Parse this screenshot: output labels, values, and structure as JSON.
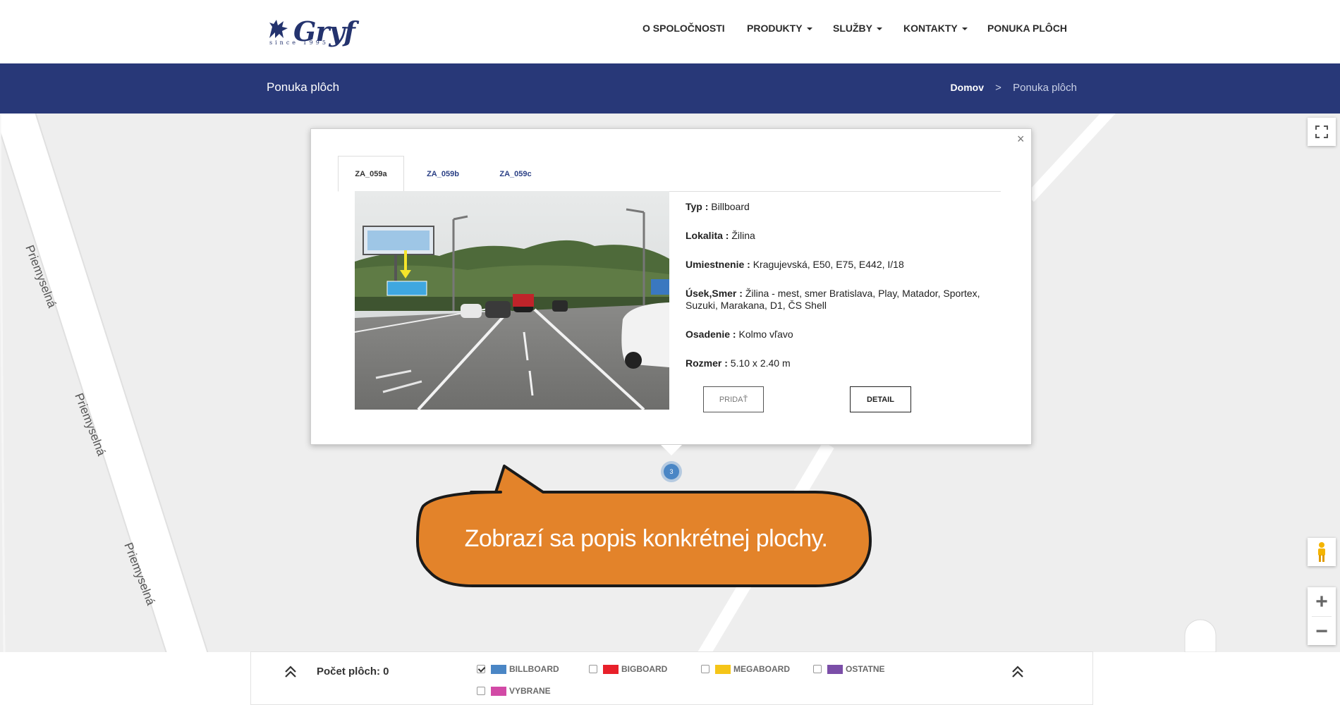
{
  "header": {
    "logo": {
      "wordmark": "Gryf",
      "tagline": "since 1995"
    },
    "nav": [
      {
        "label": "O SPOLOČNOSTI",
        "dropdown": false
      },
      {
        "label": "PRODUKTY",
        "dropdown": true
      },
      {
        "label": "SLUŽBY",
        "dropdown": true
      },
      {
        "label": "KONTAKTY",
        "dropdown": true
      },
      {
        "label": "PONUKA PLÔCH",
        "dropdown": false
      }
    ]
  },
  "titlebar": {
    "title": "Ponuka plôch",
    "breadcrumb": {
      "home": "Domov",
      "separator": ">",
      "current": "Ponuka plôch"
    },
    "background": "#283878"
  },
  "map": {
    "street_labels": [
      "Priemyselná",
      "Priemyselná",
      "Priemyselná"
    ],
    "controls": {
      "fullscreen_icon": "fullscreen-icon",
      "pegman_icon": "pegman-icon",
      "zoom_in": "+",
      "zoom_out": "−"
    },
    "cluster": {
      "count": "3",
      "color": "#4a86c5"
    }
  },
  "popup": {
    "close": "×",
    "tabs": [
      {
        "label": "ZA_059a",
        "active": true
      },
      {
        "label": "ZA_059b",
        "active": false
      },
      {
        "label": "ZA_059c",
        "active": false
      }
    ],
    "details": {
      "typ": {
        "label": "Typ :",
        "value": "Billboard"
      },
      "lokalita": {
        "label": "Lokalita :",
        "value": "Žilina"
      },
      "umiestnenie": {
        "label": "Umiestnenie :",
        "value": "Kragujevská, E50, E75, E442, I/18"
      },
      "usek": {
        "label": "Úsek,Smer :",
        "value": "Žilina - mest, smer Bratislava, Play, Matador, Sportex, Suzuki, Marakana, D1, ČS Shell"
      },
      "osadenie": {
        "label": "Osadenie :",
        "value": "Kolmo vľavo"
      },
      "rozmer": {
        "label": "Rozmer :",
        "value": "5.10 x 2.40 m"
      }
    },
    "buttons": {
      "add": "PRIDAŤ",
      "detail": "DETAIL"
    }
  },
  "callout": {
    "text": "Zobrazí sa popis konkrétnej plochy.",
    "color": "#e3832a"
  },
  "legend": {
    "count_label": "Počet plôch: 0",
    "items": [
      {
        "label": "BILLBOARD",
        "color": "#4a86c5",
        "checked": true
      },
      {
        "label": "BIGBOARD",
        "color": "#e8202a",
        "checked": false
      },
      {
        "label": "MEGABOARD",
        "color": "#f5c518",
        "checked": false
      },
      {
        "label": "OSTATNE",
        "color": "#7b4ea8",
        "checked": false
      },
      {
        "label": "VYBRANE",
        "color": "#d24aa6",
        "checked": false
      }
    ]
  }
}
